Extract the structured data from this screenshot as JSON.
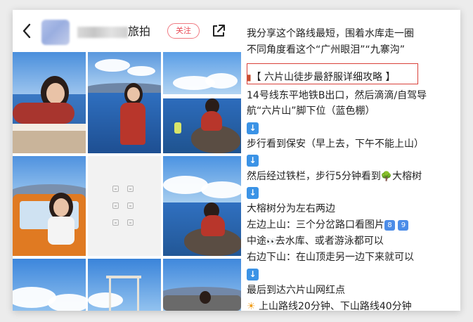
{
  "header": {
    "name_suffix": "旅拍",
    "follow_label": "关注"
  },
  "post": {
    "intro_line1": "我分享这个路线最短，围着水库走一圈",
    "intro_line2": "不同角度看这个“广州眼泪”“九寨沟”",
    "guide_title": "【 六片山徒步最舒服详细攻略 】",
    "step1_line1": "14号线东平地铁B出口，然后滴滴/自驾导",
    "step1_line2": "航“六片山”脚下位（蓝色棚）",
    "step2": "步行看到保安（早上去，下午不能上山）",
    "step3": "然后经过铁栏，步行5分钟看到",
    "step3_end": "大榕树",
    "step4_line1": "大榕树分为左右两边",
    "step4_line2_a": "左边上山：三个分岔路口看图片",
    "num8": "8",
    "num9": "9",
    "step4_line3_a": "中途",
    "step4_line3_b": "去水库、或者游泳都可以",
    "step4_line4": "右边下山：在山顶走另一边下来就可以",
    "step5": "最后到达六片山网红点",
    "step6": "上山路线20分钟、下山路线40分钟"
  },
  "icons": {
    "back": "chevron-left-icon",
    "share": "share-icon",
    "arrow": "arrow-down-icon",
    "tree": "tree-icon",
    "eyes": "eyes-icon",
    "sun": "sun-icon"
  },
  "colors": {
    "accent": "#e84a55",
    "highlight_border": "#d9413a",
    "arrow_blue": "#3b93e6"
  }
}
